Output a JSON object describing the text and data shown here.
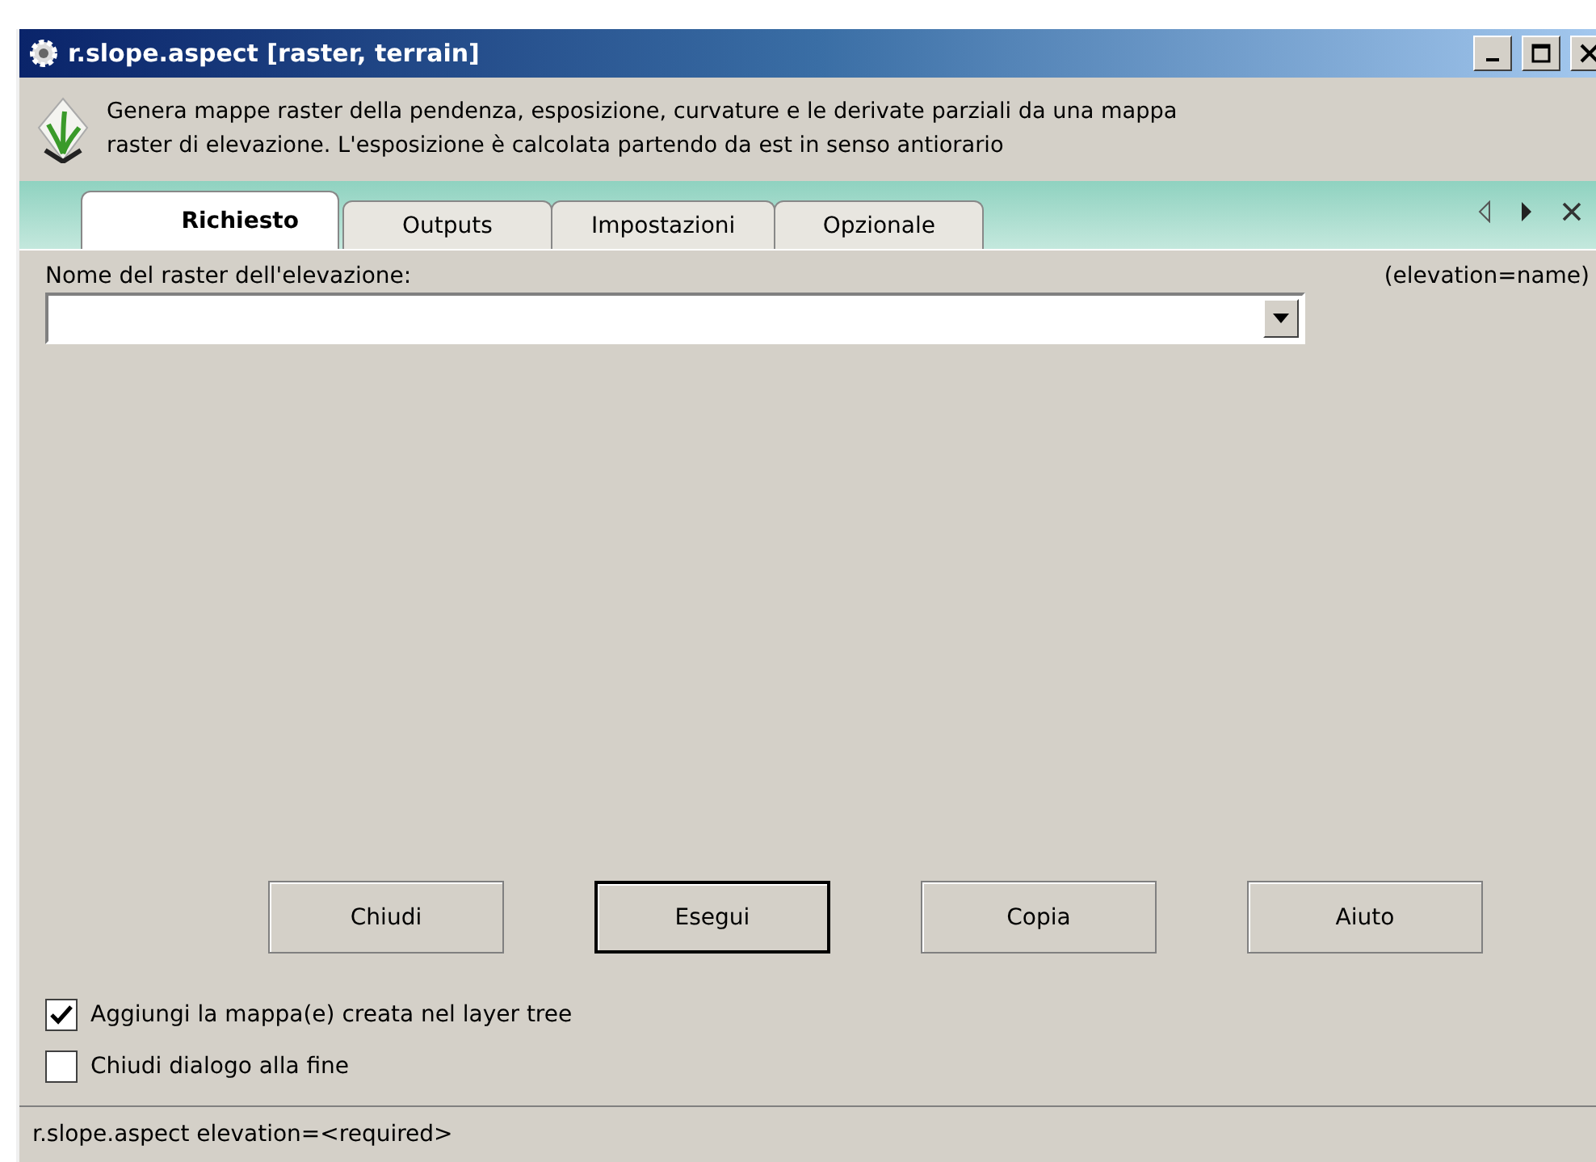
{
  "window": {
    "title": "r.slope.aspect [raster, terrain]"
  },
  "description": "Genera mappe raster della pendenza, esposizione, curvature e le derivate parziali da una mappa raster di elevazione. L'esposizione è calcolata partendo da est in senso antiorario",
  "tabs": [
    {
      "label": "Richiesto",
      "selected": true
    },
    {
      "label": "Outputs",
      "selected": false
    },
    {
      "label": "Impostazioni",
      "selected": false
    },
    {
      "label": "Opzionale",
      "selected": false
    }
  ],
  "field": {
    "label": "Nome del raster dell'elevazione:",
    "hint": "(elevation=name)"
  },
  "buttons": [
    {
      "label": "Chiudi",
      "default": false
    },
    {
      "label": "Esegui",
      "default": true
    },
    {
      "label": "Copia",
      "default": false
    },
    {
      "label": "Aiuto",
      "default": false
    }
  ],
  "options": [
    {
      "label": "Aggiungi la mappa(e) creata nel layer tree",
      "checked": true
    },
    {
      "label": "Chiudi dialogo alla fine",
      "checked": false
    }
  ],
  "status_bar": "r.slope.aspect elevation=<required>"
}
